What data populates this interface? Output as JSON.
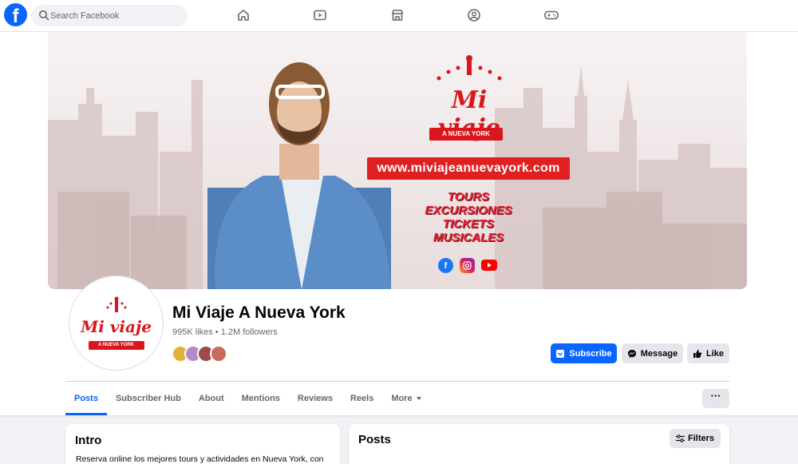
{
  "nav": {
    "logo_letter": "f",
    "search_placeholder": "Search Facebook",
    "icons": [
      "home-icon",
      "video-icon",
      "marketplace-icon",
      "groups-icon",
      "gaming-icon"
    ]
  },
  "cover": {
    "brand_title": "Mi viaje",
    "brand_ribbon": "A NUEVA YORK",
    "url": "www.miviajeanuevayork.com",
    "services": [
      "TOURS",
      "EXCURSIONES",
      "TICKETS",
      "MUSICALES"
    ]
  },
  "profile": {
    "avatar_title": "Mi viaje",
    "avatar_ribbon": "A NUEVA YORK",
    "name": "Mi Viaje A Nueva York",
    "stats": "995K likes • 1.2M followers"
  },
  "actions": {
    "subscribe": "Subscribe",
    "message": "Message",
    "like": "Like"
  },
  "tabs": [
    "Posts",
    "Subscriber Hub",
    "About",
    "Mentions",
    "Reviews",
    "Reels",
    "More"
  ],
  "more_menu_label": "···",
  "intro": {
    "title": "Intro",
    "text": "Reserva online los mejores tours y actividades en Nueva York, con"
  },
  "posts": {
    "title": "Posts",
    "filters": "Filters"
  },
  "colors": {
    "brand_blue": "#0866ff",
    "brand_red": "#d9161c",
    "background": "#f0f2f5"
  }
}
